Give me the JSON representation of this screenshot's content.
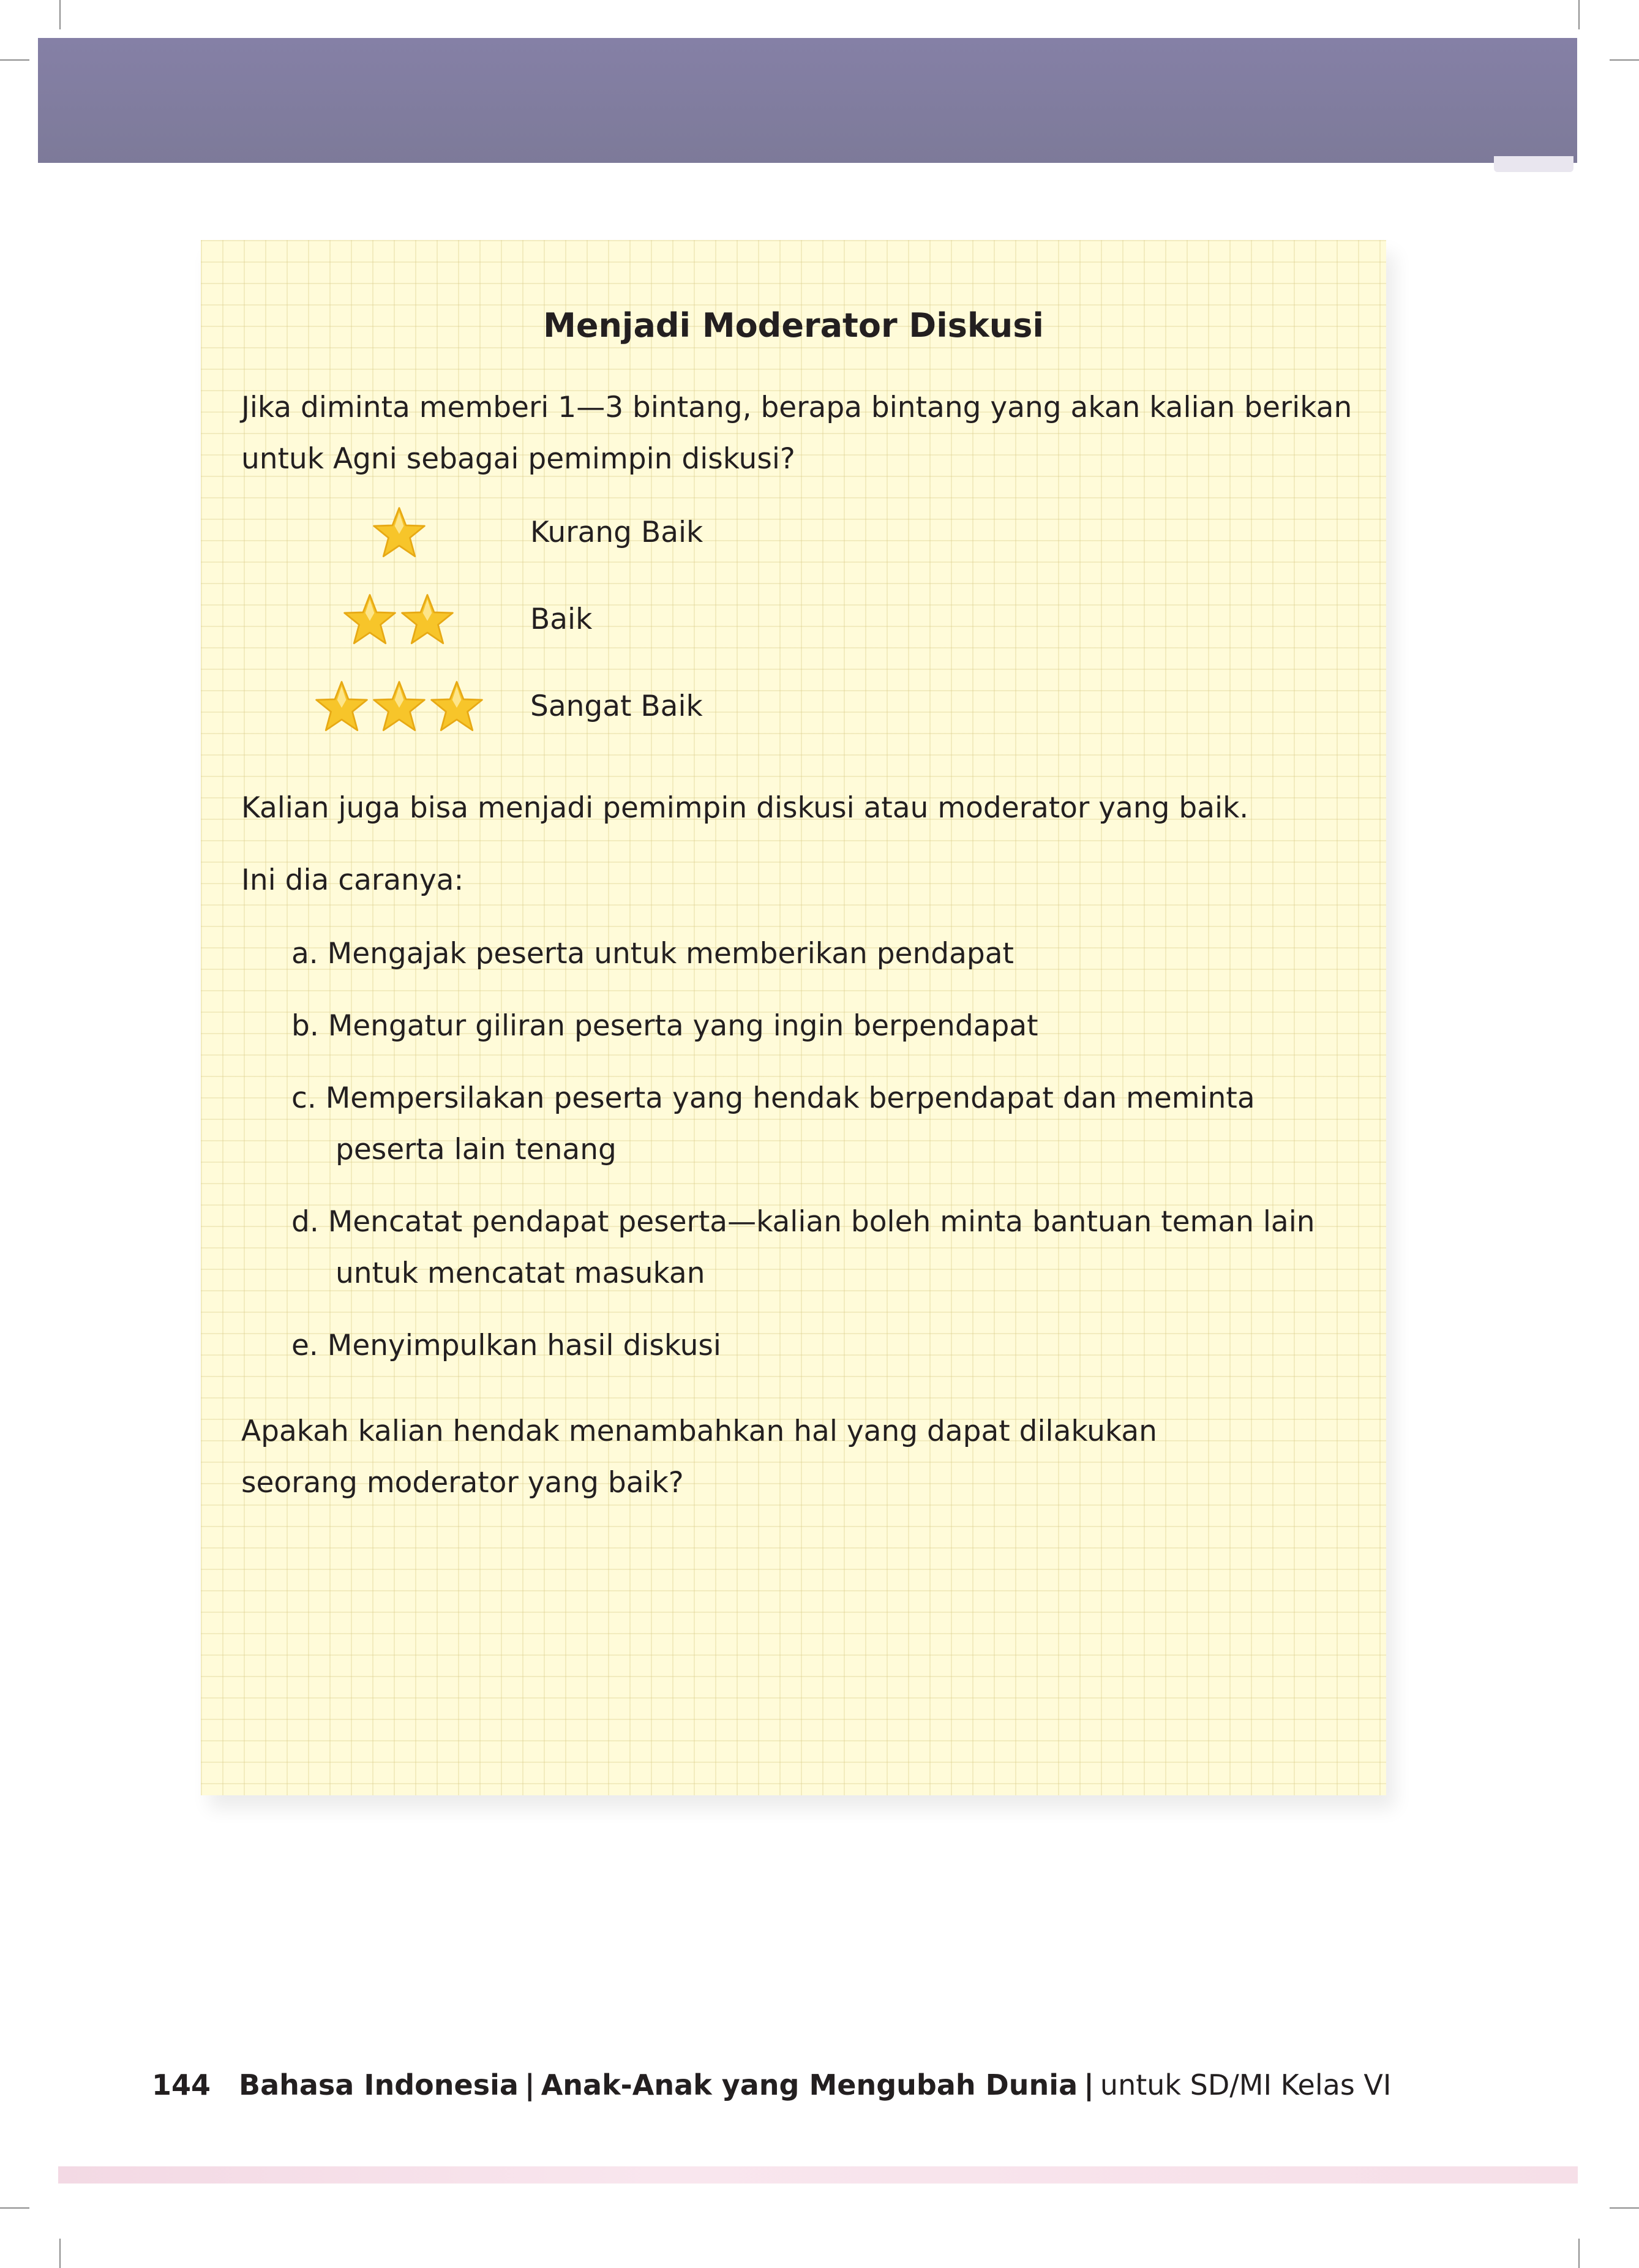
{
  "card": {
    "title": "Menjadi Moderator Diskusi",
    "question": "Jika diminta memberi 1—3 bintang, berapa bintang yang akan kalian berikan untuk Agni sebagai pemimpin diskusi?",
    "ratings": [
      {
        "stars": 1,
        "label": "Kurang Baik"
      },
      {
        "stars": 2,
        "label": "Baik"
      },
      {
        "stars": 3,
        "label": "Sangat Baik"
      }
    ],
    "intro": "Kalian juga bisa menjadi pemimpin diskusi atau moderator yang baik.",
    "lead": "Ini dia caranya:",
    "steps": [
      "a. Mengajak peserta untuk memberikan pendapat",
      "b. Mengatur giliran peserta yang ingin berpendapat",
      "c. Mempersilakan peserta yang hendak berpendapat dan meminta peserta lain tenang",
      "d. Mencatat pendapat peserta—kalian boleh minta bantuan teman lain untuk mencatat masukan",
      "e. Menyimpulkan hasil diskusi"
    ],
    "closing": "Apakah kalian hendak menambahkan hal yang dapat dilakukan seorang moderator yang baik?"
  },
  "footer": {
    "page_number": "144",
    "subject": "Bahasa Indonesia",
    "separator": "|",
    "book_title": "Anak-Anak yang Mengubah Dunia",
    "grade": "untuk SD/MI Kelas VI"
  },
  "colors": {
    "header_band": "#8580a6",
    "card_background": "#fffbd9",
    "star_fill": "#f7c52a",
    "footer_band": "#f3d9e4"
  },
  "icons": {
    "rating": "star-icon"
  }
}
